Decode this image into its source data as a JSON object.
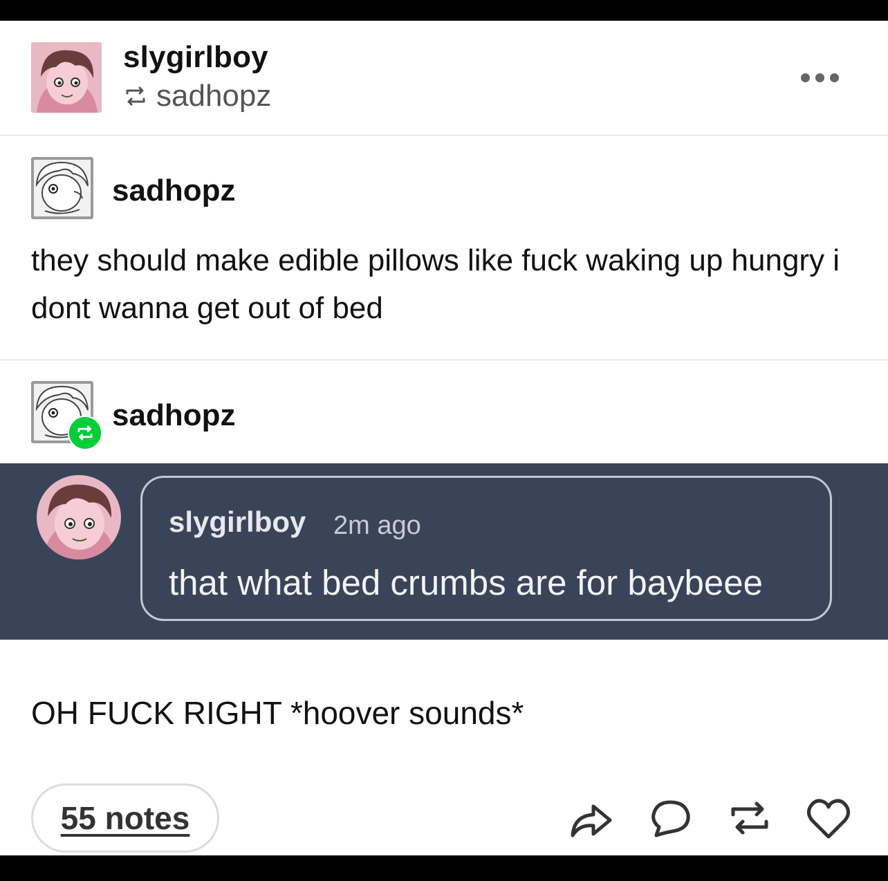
{
  "post": {
    "blog_name": "slygirlboy",
    "reblogged_from": "sadhopz",
    "more_label": "More options"
  },
  "trail": [
    {
      "blog_name": "sadhopz",
      "text": "they should make edible pillows like fuck waking up hungry i dont wanna get out of bed"
    },
    {
      "blog_name": "sadhopz",
      "embedded_comment": {
        "user": "slygirlboy",
        "time": "2m ago",
        "text": "that what bed crumbs are for baybeee"
      },
      "text": "OH FUCK RIGHT *hoover sounds*"
    }
  ],
  "footer": {
    "notes": "55 notes",
    "actions": [
      "share-icon",
      "reply-icon",
      "reblog-icon",
      "like-icon"
    ]
  },
  "colors": {
    "embed_background": "#3a4459",
    "reblog_green": "#00cf35",
    "divider": "#d8d8d8"
  }
}
